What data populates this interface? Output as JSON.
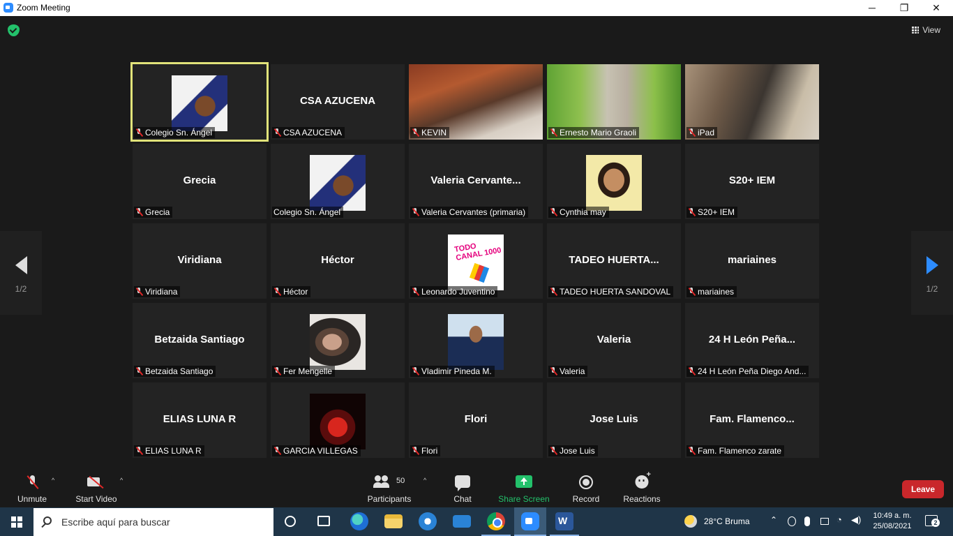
{
  "window": {
    "title": "Zoom Meeting",
    "controls": {
      "minimize": "─",
      "maximize": "❐",
      "close": "✕"
    }
  },
  "meeting": {
    "view_label": "View",
    "page_left": "1/2",
    "page_right": "1/2",
    "tiles": [
      {
        "name": "Colegio Sn. Ángel",
        "muted": true,
        "kind": "avatar",
        "avatar": "bear",
        "active": true
      },
      {
        "name": "CSA AZUCENA",
        "display": "CSA AZUCENA",
        "muted": true,
        "kind": "text"
      },
      {
        "name": "KEVIN",
        "muted": true,
        "kind": "video",
        "video": "kevin"
      },
      {
        "name": "Ernesto Mario Graoli",
        "muted": true,
        "kind": "video",
        "video": "ernesto"
      },
      {
        "name": "iPad",
        "muted": true,
        "kind": "video",
        "video": "ipad"
      },
      {
        "name": "Grecia",
        "display": "Grecia",
        "muted": true,
        "kind": "text"
      },
      {
        "name": "Colegio Sn. Ángel",
        "muted": false,
        "kind": "avatar",
        "avatar": "bear"
      },
      {
        "name": "Valeria Cervantes  (primaria)",
        "display": "Valeria  Cervante...",
        "muted": true,
        "kind": "text"
      },
      {
        "name": "Cynthia may",
        "muted": true,
        "kind": "avatar",
        "avatar": "cynthia"
      },
      {
        "name": "S20+ IEM",
        "display": "S20+ IEM",
        "muted": true,
        "kind": "text"
      },
      {
        "name": "Viridiana",
        "display": "Viridiana",
        "muted": true,
        "kind": "text"
      },
      {
        "name": "Héctor",
        "display": "Héctor",
        "muted": true,
        "kind": "text"
      },
      {
        "name": "Leonardo Juventino",
        "muted": true,
        "kind": "avatar",
        "avatar": "logo",
        "logo_text": "TODO CANAL 1000"
      },
      {
        "name": "TADEO HUERTA SANDOVAL",
        "display": "TADEO  HUERTA...",
        "muted": true,
        "kind": "text"
      },
      {
        "name": "mariaines",
        "display": "mariaines",
        "muted": true,
        "kind": "text"
      },
      {
        "name": "Betzaida Santiago",
        "display": "Betzaida Santiago",
        "muted": true,
        "kind": "text"
      },
      {
        "name": "Fer Mengelle",
        "muted": true,
        "kind": "avatar",
        "avatar": "fer"
      },
      {
        "name": "Vladimir Pineda M.",
        "muted": true,
        "kind": "avatar",
        "avatar": "vladimir"
      },
      {
        "name": "Valeria",
        "display": "Valeria",
        "muted": true,
        "kind": "text"
      },
      {
        "name": "24 H León Peña Diego And...",
        "display": "24 H León Peña...",
        "muted": true,
        "kind": "text"
      },
      {
        "name": "ELIAS LUNA R",
        "display": "ELIAS LUNA R",
        "muted": true,
        "kind": "text"
      },
      {
        "name": "GARCIA VILLEGAS",
        "muted": true,
        "kind": "avatar",
        "avatar": "garcia"
      },
      {
        "name": "Flori",
        "display": "Flori",
        "muted": true,
        "kind": "text"
      },
      {
        "name": "Jose Luis",
        "display": "Jose Luis",
        "muted": true,
        "kind": "text"
      },
      {
        "name": "Fam. Flamenco zarate",
        "display": "Fam.  Flamenco...",
        "muted": true,
        "kind": "text"
      }
    ]
  },
  "toolbar": {
    "unmute": "Unmute",
    "start_video": "Start Video",
    "participants": "Participants",
    "participants_count": "50",
    "chat": "Chat",
    "share_screen": "Share Screen",
    "record": "Record",
    "reactions": "Reactions",
    "leave": "Leave"
  },
  "taskbar": {
    "search_placeholder": "Escribe aquí para buscar",
    "weather": "28°C  Bruma",
    "time": "10:49 a. m.",
    "date": "25/08/2021",
    "notifications": "2"
  },
  "colors": {
    "zoom_blue": "#2d8cff",
    "active_speaker": "#e1e37a",
    "share_green": "#23c16b",
    "leave_red": "#c9272b",
    "taskbar": "#1f3548"
  }
}
